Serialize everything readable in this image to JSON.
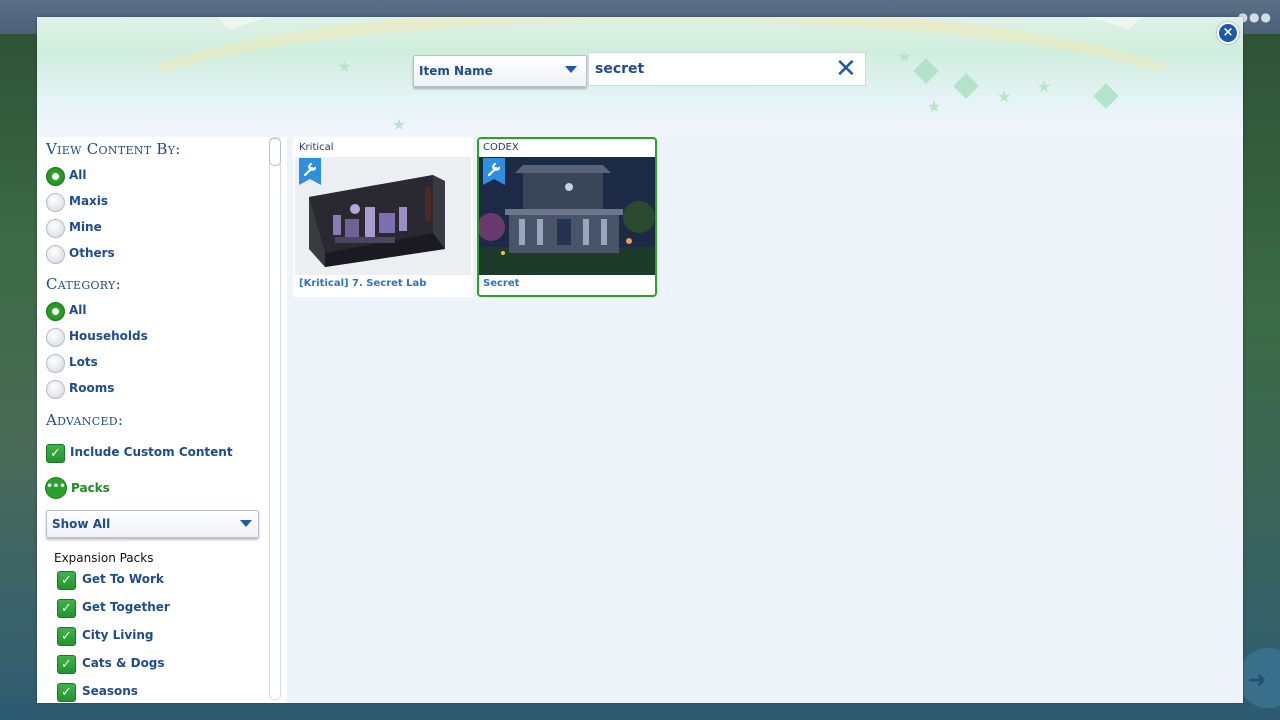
{
  "dialog": {
    "close_label": "×"
  },
  "search": {
    "type_label": "Item Name",
    "query": "secret",
    "clear_glyph": "✕"
  },
  "filters": {
    "view_content": {
      "title": "View Content By:",
      "options": [
        "All",
        "Maxis",
        "Mine",
        "Others"
      ],
      "selected": "All"
    },
    "category": {
      "title": "Category:",
      "options": [
        "All",
        "Households",
        "Lots",
        "Rooms"
      ],
      "selected": "All"
    },
    "advanced": {
      "title": "Advanced:",
      "include_cc": "Include Custom Content",
      "packs": "Packs",
      "packs_dropdown": "Show All",
      "expansion_heading": "Expansion Packs",
      "expansion_packs": [
        "Get To Work",
        "Get Together",
        "City Living",
        "Cats & Dogs",
        "Seasons"
      ]
    }
  },
  "results": [
    {
      "creator": "Kritical",
      "title": "[Kritical] 7. Secret Lab",
      "selected": false,
      "icon": "wrench-tag-icon"
    },
    {
      "creator": "CODEX",
      "title": "Secret",
      "selected": true,
      "icon": "wrench-tag-icon"
    }
  ],
  "colors": {
    "accent_blue": "#1f4c8e",
    "link_blue": "#2a74c2",
    "green": "#2aa12a"
  }
}
